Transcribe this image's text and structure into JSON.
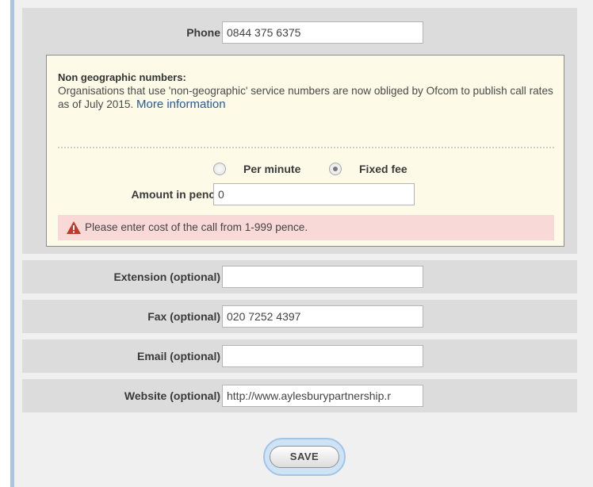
{
  "phone": {
    "label": "Phone",
    "value": "0844 375 6375"
  },
  "notice": {
    "title": "Non geographic numbers:",
    "body": "Organisations that use 'non-geographic' service numbers are now obliged by Ofcom to publish call rates as of July 2015.",
    "link": "More information"
  },
  "rate_type": {
    "options": [
      {
        "label": "Per minute",
        "checked": false
      },
      {
        "label": "Fixed fee",
        "checked": true
      }
    ]
  },
  "amount": {
    "label": "Amount in pence",
    "value": "0"
  },
  "error": {
    "text": "Please enter cost of the call from 1-999 pence.",
    "icon": "warning-icon"
  },
  "extension": {
    "label": "Extension (optional)",
    "value": ""
  },
  "fax": {
    "label": "Fax (optional)",
    "value": "020 7252 4397"
  },
  "email": {
    "label": "Email (optional)",
    "value": ""
  },
  "website": {
    "label": "Website (optional)",
    "value": "http://www.aylesburypartnership.r"
  },
  "save_label": "SAVE",
  "colors": {
    "accent": "#a8c6e0",
    "notice_bg": "#fdfbe8",
    "error_bg": "#f9d8d8",
    "link": "#2a5a96"
  }
}
